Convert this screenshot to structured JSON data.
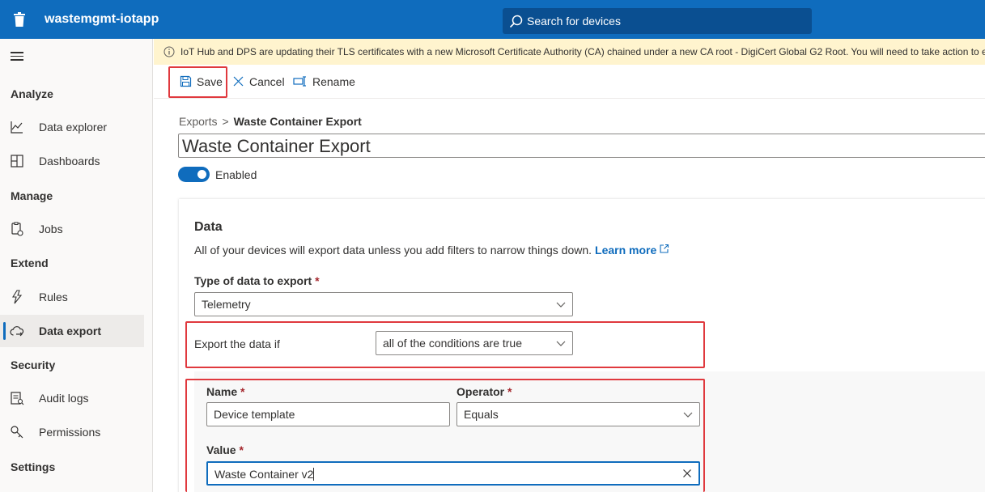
{
  "app": {
    "name": "wastemgmt-iotapp"
  },
  "search": {
    "placeholder": "Search for devices"
  },
  "sidebar": {
    "sections": [
      {
        "title": "Analyze",
        "items": [
          {
            "label": "Data explorer",
            "icon": "chart-line-icon"
          },
          {
            "label": "Dashboards",
            "icon": "dashboard-grid-icon"
          }
        ]
      },
      {
        "title": "Manage",
        "items": [
          {
            "label": "Jobs",
            "icon": "jobs-icon"
          }
        ]
      },
      {
        "title": "Extend",
        "items": [
          {
            "label": "Rules",
            "icon": "rules-icon"
          },
          {
            "label": "Data export",
            "icon": "cloud-export-icon",
            "active": true
          }
        ]
      },
      {
        "title": "Security",
        "items": [
          {
            "label": "Audit logs",
            "icon": "audit-log-icon"
          },
          {
            "label": "Permissions",
            "icon": "key-icon"
          }
        ]
      },
      {
        "title": "Settings",
        "items": []
      }
    ]
  },
  "banner": {
    "text": "IoT Hub and DPS are updating their TLS certificates with a new Microsoft Certificate Authority (CA) chained under a new CA root - DigiCert Global G2 Root. You will need to take action to ensure you"
  },
  "toolbar": {
    "save": "Save",
    "cancel": "Cancel",
    "rename": "Rename"
  },
  "breadcrumb": {
    "parent": "Exports",
    "separator": ">",
    "current": "Waste Container Export"
  },
  "export": {
    "name": "Waste Container Export",
    "enabled_label": "Enabled",
    "enabled": true
  },
  "data_card": {
    "title": "Data",
    "description": "All of your devices will export data unless you add filters to narrow things down.",
    "learn_more": "Learn more",
    "type_label": "Type of data to export",
    "type_value": "Telemetry",
    "condition_label": "Export the data if",
    "condition_value": "all of the conditions are true",
    "required_marker": "*"
  },
  "filter": {
    "name_label": "Name",
    "name_value": "Device template",
    "operator_label": "Operator",
    "operator_value": "Equals",
    "value_label": "Value",
    "value_value": "Waste Container v2"
  },
  "colors": {
    "brand": "#0f6cbd",
    "highlight": "#e0393e",
    "banner_bg": "#fff4ce",
    "required": "#a4262c"
  }
}
